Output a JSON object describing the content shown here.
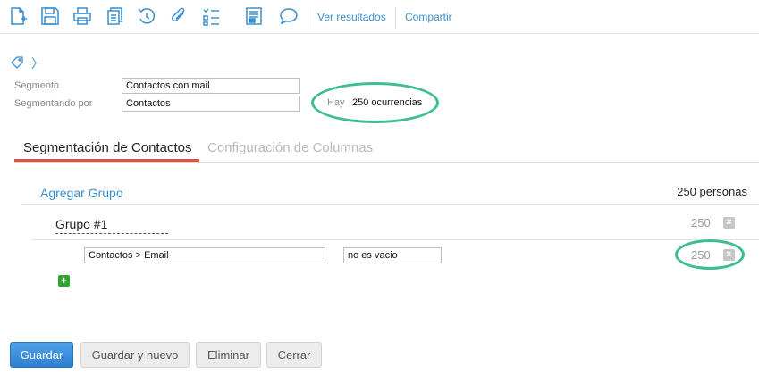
{
  "toolbar": {
    "icons": [
      "new-document-icon",
      "save-icon",
      "print-icon",
      "copy-icon",
      "history-icon",
      "attachment-icon",
      "checklist-icon",
      "report-icon",
      "comment-icon"
    ],
    "links": {
      "ver_resultados": "Ver resultados",
      "compartir": "Compartir"
    },
    "icon_color": "#3a8fd0"
  },
  "breadcrumb": {
    "separator": "〉"
  },
  "form": {
    "segmento_label": "Segmento",
    "segmento_value": "Contactos con mail",
    "segmentando_label": "Segmentando por",
    "segmentando_value": "Contactos",
    "hay_label": "Hay",
    "ocurrencias": "250 ocurrencias"
  },
  "tabs": [
    {
      "label": "Segmentación de Contactos",
      "active": true
    },
    {
      "label": "Configuración de Columnas",
      "active": false
    }
  ],
  "segmentation": {
    "add_group_label": "Agregar Grupo",
    "total": "250 personas",
    "groups": [
      {
        "title": "Grupo #1",
        "count": "250",
        "conditions": [
          {
            "field": "Contactos > Email",
            "operator": "no es vacio",
            "count": "250"
          }
        ]
      }
    ]
  },
  "buttons": {
    "guardar": "Guardar",
    "guardar_nuevo": "Guardar y nuevo",
    "eliminar": "Eliminar",
    "cerrar": "Cerrar"
  },
  "colors": {
    "accent": "#3a8fd0",
    "tab_underline": "#e0503d",
    "highlight": "#3dbd93",
    "add_green": "#2fa52f"
  }
}
